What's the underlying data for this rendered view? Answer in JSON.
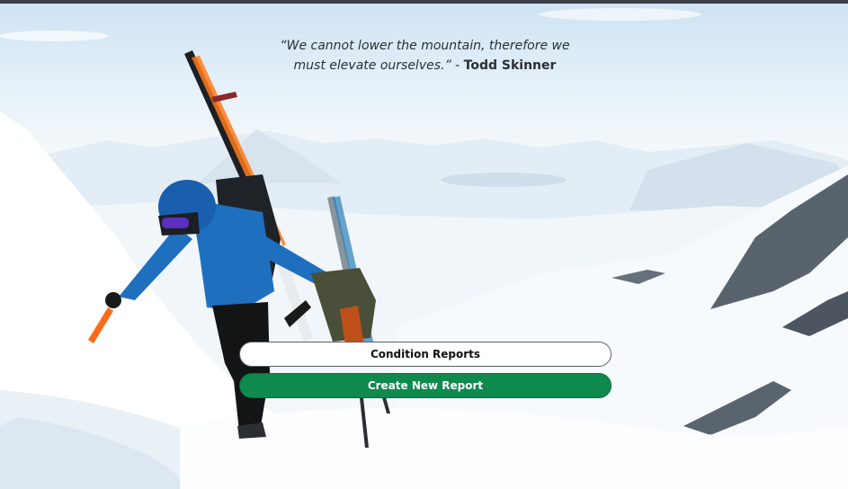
{
  "quote": {
    "text": "“We cannot lower the mountain, therefore we must elevate ourselves.”",
    "separator": " - ",
    "author": "Todd Skinner"
  },
  "actions": {
    "condition_reports_label": "Condition Reports",
    "create_report_label": "Create New Report"
  },
  "colors": {
    "primary_button": "#0f8a4f",
    "secondary_button": "#ffffff",
    "jacket": "#1f6fbf"
  }
}
